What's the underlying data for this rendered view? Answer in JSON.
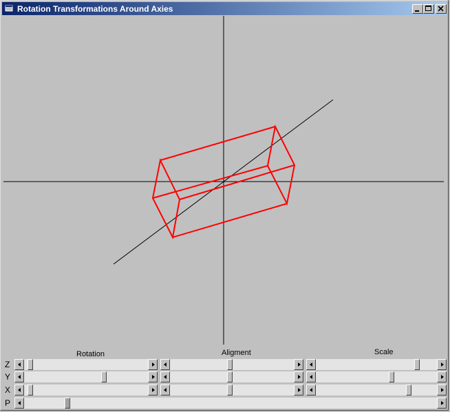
{
  "window": {
    "title": "Rotation Transformations Around Axies"
  },
  "controls": {
    "headers": {
      "rotation": "Rotation",
      "alignment": "Aligment",
      "scale": "Scale"
    },
    "rows": [
      {
        "label": "Z",
        "rotation": 0.03,
        "alignment": 0.48,
        "scale": 0.85
      },
      {
        "label": "Y",
        "rotation": 0.65,
        "alignment": 0.48,
        "scale": 0.63
      },
      {
        "label": "X",
        "rotation": 0.03,
        "alignment": 0.48,
        "scale": 0.78
      }
    ],
    "p_row": {
      "label": "P",
      "value": 0.1
    }
  },
  "colors": {
    "axis": "#000000",
    "box": "#ff0000",
    "background": "#c0c0c0",
    "titlebar_start": "#0a246a",
    "titlebar_end": "#a6caf0"
  },
  "icons": {
    "system": "window-app-icon",
    "minimize": "minimize-icon",
    "maximize": "maximize-icon",
    "close": "close-icon"
  }
}
